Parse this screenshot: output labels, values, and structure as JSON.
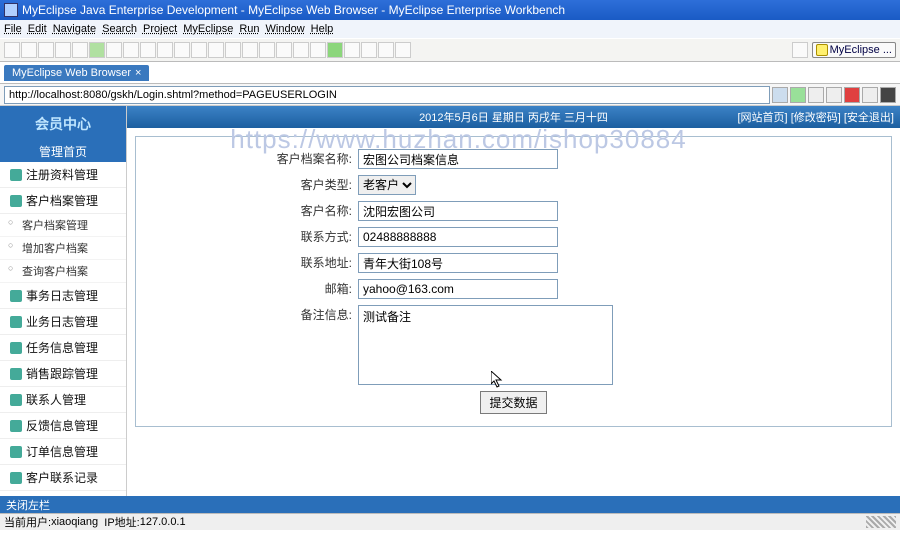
{
  "title": "MyEclipse Java Enterprise Development - MyEclipse Web Browser - MyEclipse Enterprise Workbench",
  "menu": [
    "File",
    "Edit",
    "Navigate",
    "Search",
    "Project",
    "MyEclipse",
    "Run",
    "Window",
    "Help"
  ],
  "top_right_btn": "MyEclipse ...",
  "tab": {
    "label": "MyEclipse Web Browser",
    "close": "×"
  },
  "url": "http://localhost:8080/gskh/Login.shtml?method=PAGEUSERLOGIN",
  "logo": "会员中心",
  "nav_head": "管理首页",
  "nav": [
    "注册资料管理",
    "客户档案管理",
    "事务日志管理",
    "业务日志管理",
    "任务信息管理",
    "销售跟踪管理",
    "联系人管理",
    "反馈信息管理",
    "订单信息管理",
    "客户联系记录"
  ],
  "subnav": [
    "客户档案管理",
    "增加客户档案",
    "查询客户档案"
  ],
  "header": {
    "date": "2012年5月6日 星期日 丙戌年 三月十四",
    "links": [
      "[网站首页]",
      "[修改密码]",
      "[安全退出]"
    ]
  },
  "watermark": "https://www.huzhan.com/ishop30884",
  "form": {
    "fields": {
      "name": {
        "label": "客户档案名称:",
        "value": "宏图公司档案信息"
      },
      "type": {
        "label": "客户类型:",
        "value": "老客户"
      },
      "cname": {
        "label": "客户名称:",
        "value": "沈阳宏图公司"
      },
      "contact": {
        "label": "联系方式:",
        "value": "02488888888"
      },
      "addr": {
        "label": "联系地址:",
        "value": "青年大街108号"
      },
      "email": {
        "label": "邮箱:",
        "value": "yahoo@163.com"
      },
      "note": {
        "label": "备注信息:",
        "value": "测试备注"
      }
    },
    "submit": "提交数据"
  },
  "footer": "关闭左栏",
  "status": {
    "user_lbl": "当前用户:",
    "user": "xiaoqiang",
    "ip_lbl": "IP地址:",
    "ip": "127.0.0.1"
  }
}
